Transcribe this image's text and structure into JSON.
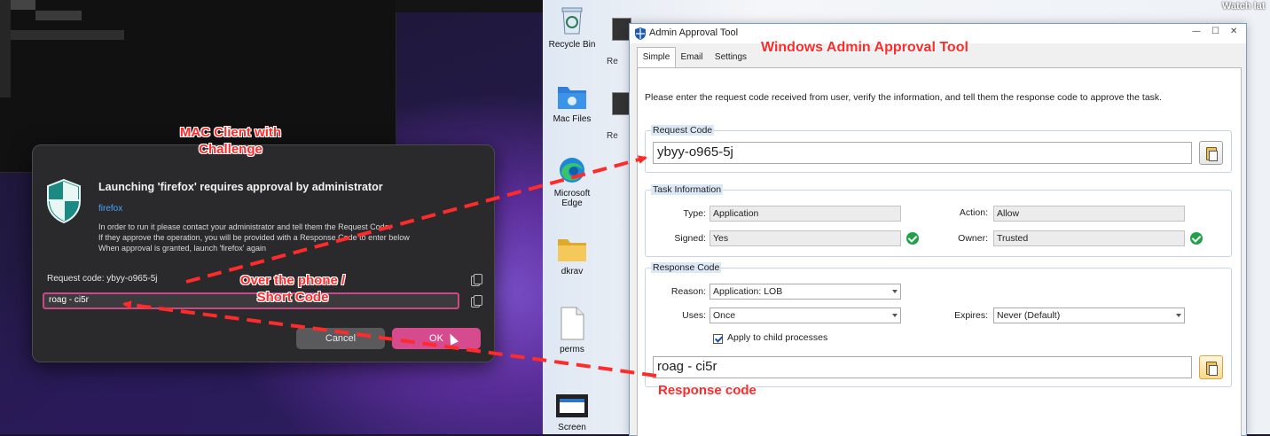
{
  "mac_dialog": {
    "title": "Launching 'firefox' requires approval by administrator",
    "app_name": "firefox",
    "body_lines": [
      "In order to run it please contact your administrator and tell them the Request Code.",
      "If they approve the operation, you will be provided with a Response Code to enter below",
      "When approval is granted, launch 'firefox' again"
    ],
    "request_code_text": "Request code: ybyy-o965-5j",
    "response_input_value": "roag - ci5r",
    "cancel_label": "Cancel",
    "ok_label": "OK"
  },
  "desktop_icons": [
    {
      "label": "Recycle Bin",
      "icon": "recycle-bin-icon"
    },
    {
      "label": "Mac Files",
      "icon": "mac-folder-icon"
    },
    {
      "label": "Microsoft Edge",
      "icon": "edge-icon"
    },
    {
      "label": "dkrav",
      "icon": "folder-icon"
    },
    {
      "label": "perms",
      "icon": "file-icon"
    },
    {
      "label": "Screen",
      "icon": "screen-icon"
    }
  ],
  "desktop_fragments": [
    "Re",
    "Re"
  ],
  "admin_tool": {
    "window_title": "Admin Approval Tool",
    "tabs": [
      "Simple",
      "Email",
      "Settings"
    ],
    "instructions": "Please enter the request code received from user, verify the information, and tell them the response code to approve the task.",
    "request_code": {
      "group_label": "Request Code",
      "value": "ybyy-o965-5j"
    },
    "task_info": {
      "group_label": "Task Information",
      "type_label": "Type:",
      "type_value": "Application",
      "action_label": "Action:",
      "action_value": "Allow",
      "signed_label": "Signed:",
      "signed_value": "Yes",
      "owner_label": "Owner:",
      "owner_value": "Trusted"
    },
    "response": {
      "group_label": "Response Code",
      "reason_label": "Reason:",
      "reason_value": "Application: LOB",
      "uses_label": "Uses:",
      "uses_value": "Once",
      "expires_label": "Expires:",
      "expires_value": "Never (Default)",
      "apply_child_label": "Apply to child processes",
      "value": "roag - ci5r"
    }
  },
  "annotations": {
    "windows_tool": "Windows Admin Approval Tool",
    "mac_client_line1": "MAC Client with",
    "mac_client_line2": "Challenge",
    "phone_line1": "Over the phone /",
    "phone_line2": "Short Code",
    "response_code": "Response code"
  },
  "overlay_text": "Watch lat",
  "colors": {
    "annotation_red": "#ff2a2a",
    "mac_ok_pink": "#d64a8e",
    "shield_teal": "#1a8a82",
    "check_green": "#1fa14a"
  }
}
